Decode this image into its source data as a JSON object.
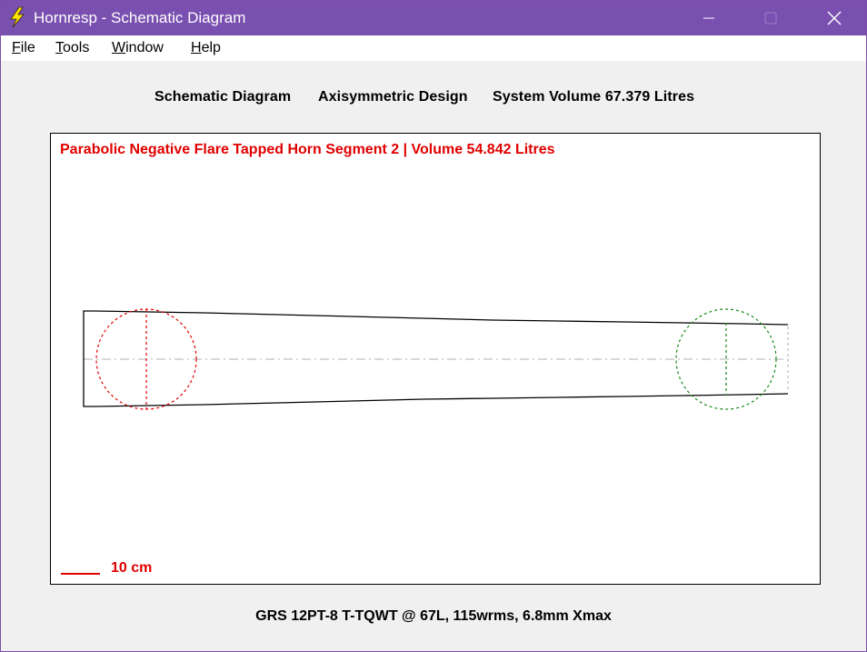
{
  "window": {
    "title": "Hornresp - Schematic Diagram",
    "titlebar_color": "#7950b0"
  },
  "menu": [
    {
      "first": "F",
      "rest": "ile"
    },
    {
      "first": "T",
      "rest": "ools"
    },
    {
      "first": "W",
      "rest": "indow"
    },
    {
      "first": "H",
      "rest": "elp"
    }
  ],
  "header": {
    "diagram_label": "Schematic Diagram",
    "design_label": "Axisymmetric Design",
    "volume_label": "System Volume 67.379 Litres"
  },
  "diagram": {
    "segment_title": "Parabolic Negative Flare Tapped Horn Segment 2 | Volume 54.842 Litres",
    "scale_label": "10 cm",
    "colors": {
      "outline": "#000000",
      "driver_1": "#e00000",
      "driver_2": "#1a8a1a",
      "axis": "#b0b0b0",
      "annotation": "#e00000"
    }
  },
  "footer": {
    "description": "GRS 12PT-8 T-TQWT @ 67L, 115wrms, 6.8mm Xmax"
  },
  "icons": {
    "app": "lightning-bolt-icon",
    "minimize": "minimize-icon",
    "maximize": "maximize-icon",
    "close": "close-icon"
  }
}
